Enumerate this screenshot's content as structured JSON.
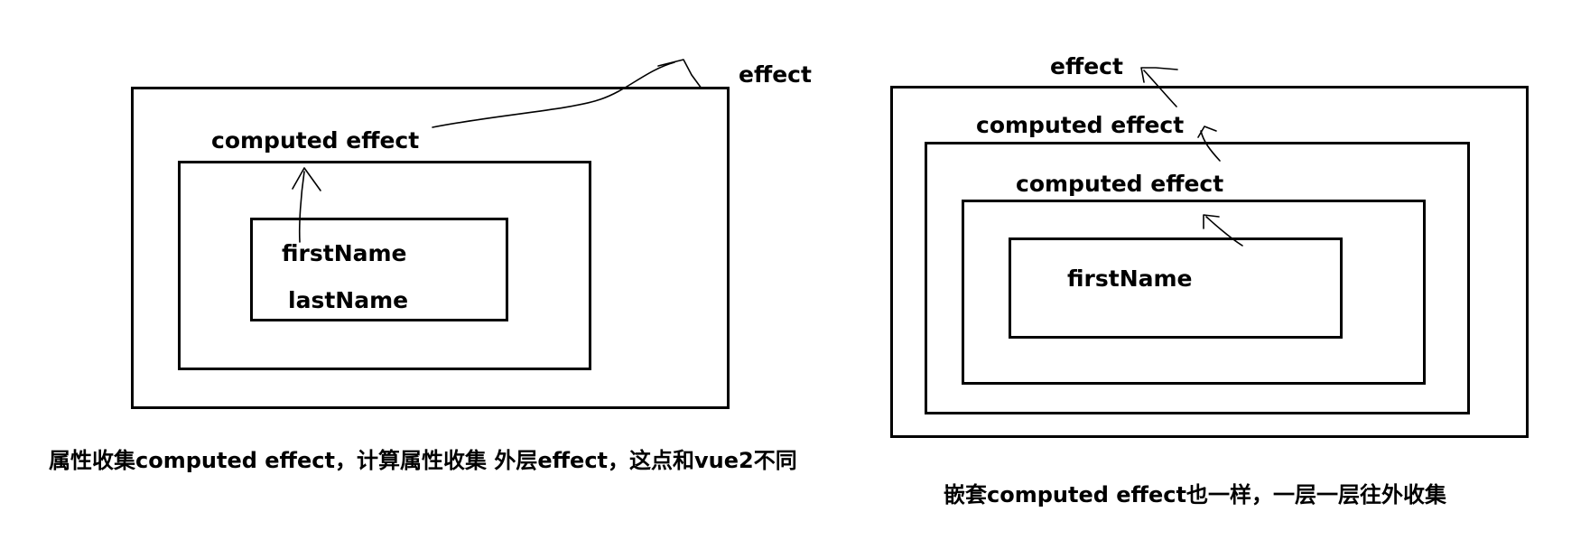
{
  "left_diagram": {
    "outer_label": "effect",
    "middle_label": "computed effect",
    "inner_fields": [
      "firstName",
      "lastName"
    ],
    "caption": "属性收集computed effect，计算属性收集 外层effect，这点和vue2不同"
  },
  "right_diagram": {
    "outer_label": "effect",
    "level2_label": "computed effect",
    "level3_label": "computed effect",
    "inner_field": "firstName",
    "caption": "嵌套computed effect也一样，一层一层往外收集"
  },
  "colors": {
    "background": "#ffffff",
    "ink": "#000000"
  }
}
